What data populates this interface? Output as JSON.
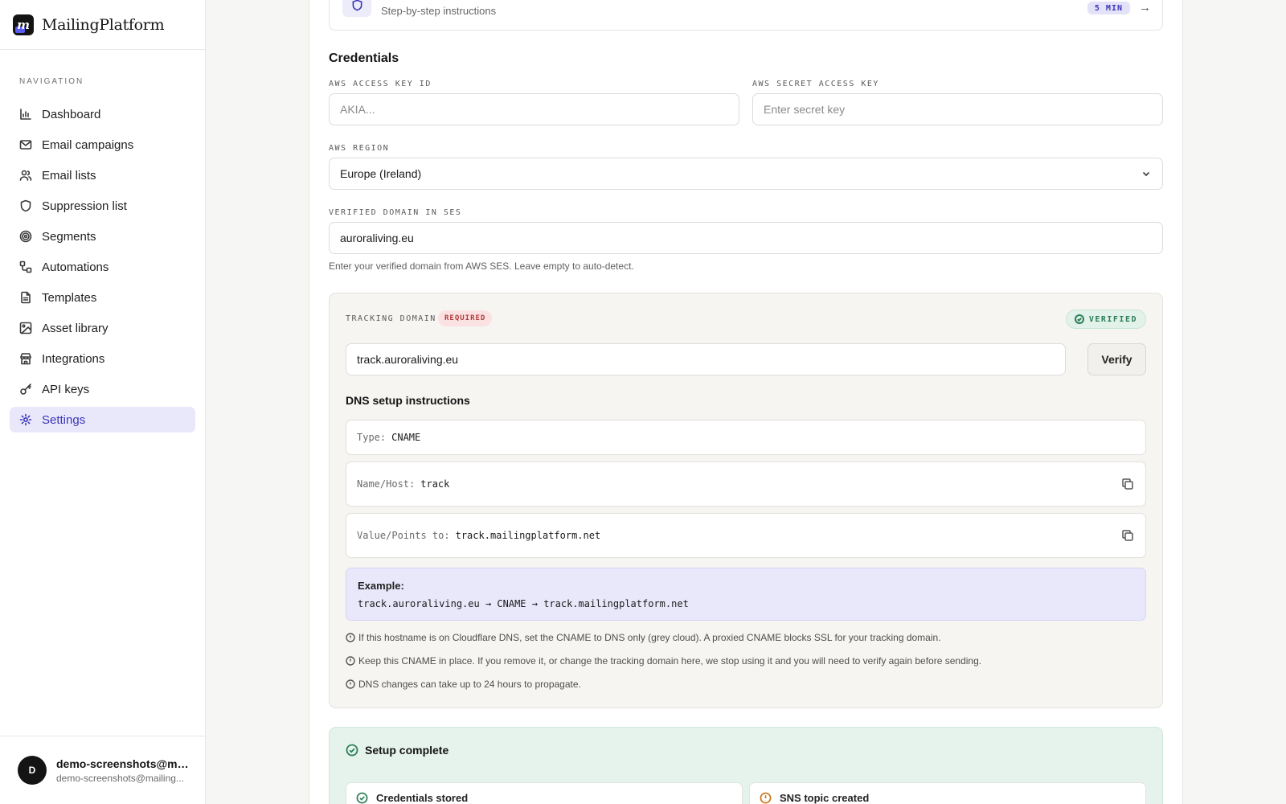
{
  "brand": {
    "name": "MailingPlatform",
    "logo_letter": "m"
  },
  "nav": {
    "heading": "NAVIGATION",
    "items": [
      {
        "label": "Dashboard",
        "icon": "bar-chart-icon"
      },
      {
        "label": "Email campaigns",
        "icon": "mail-icon"
      },
      {
        "label": "Email lists",
        "icon": "users-icon"
      },
      {
        "label": "Suppression list",
        "icon": "shield-icon"
      },
      {
        "label": "Segments",
        "icon": "target-icon"
      },
      {
        "label": "Automations",
        "icon": "workflow-icon"
      },
      {
        "label": "Templates",
        "icon": "file-text-icon"
      },
      {
        "label": "Asset library",
        "icon": "image-icon"
      },
      {
        "label": "Integrations",
        "icon": "store-icon"
      },
      {
        "label": "API keys",
        "icon": "key-icon"
      },
      {
        "label": "Settings",
        "icon": "gear-icon",
        "active": true
      }
    ]
  },
  "user": {
    "initial": "D",
    "name": "demo-screenshots@ma...",
    "email": "demo-screenshots@mailing..."
  },
  "guide": {
    "subtitle": "Step-by-step instructions",
    "duration": "5 MIN"
  },
  "credentials": {
    "title": "Credentials",
    "access_key_label": "AWS ACCESS KEY ID",
    "access_key_placeholder": "AKIA...",
    "secret_key_label": "AWS SECRET ACCESS KEY",
    "secret_key_placeholder": "Enter secret key",
    "region_label": "AWS REGION",
    "region_value": "Europe (Ireland)",
    "domain_label": "VERIFIED DOMAIN IN SES",
    "domain_value": "auroraliving.eu",
    "domain_hint": "Enter your verified domain from AWS SES. Leave empty to auto-detect."
  },
  "tracking": {
    "label": "TRACKING DOMAIN",
    "required_badge": "REQUIRED",
    "status": "VERIFIED",
    "domain_value": "track.auroraliving.eu",
    "verify_label": "Verify",
    "dns_title": "DNS setup instructions",
    "records": [
      {
        "key": "Type:",
        "value": "CNAME"
      },
      {
        "key": "Name/Host:",
        "value": "track"
      },
      {
        "key": "Value/Points to:",
        "value": "track.mailingplatform.net"
      }
    ],
    "example_title": "Example:",
    "example_line": "track.auroraliving.eu → CNAME → track.mailingplatform.net",
    "notes": [
      "If this hostname is on Cloudflare DNS, set the CNAME to DNS only (grey cloud). A proxied CNAME blocks SSL for your tracking domain.",
      "Keep this CNAME in place. If you remove it, or change the tracking domain here, we stop using it and you will need to verify again before sending.",
      "DNS changes can take up to 24 hours to propagate."
    ]
  },
  "setup": {
    "title": "Setup complete",
    "steps": [
      {
        "label": "Credentials stored",
        "status": "done",
        "color": "#2c7d57"
      },
      {
        "label": "SNS topic created",
        "status": "warning",
        "color": "#c7781a"
      }
    ]
  }
}
